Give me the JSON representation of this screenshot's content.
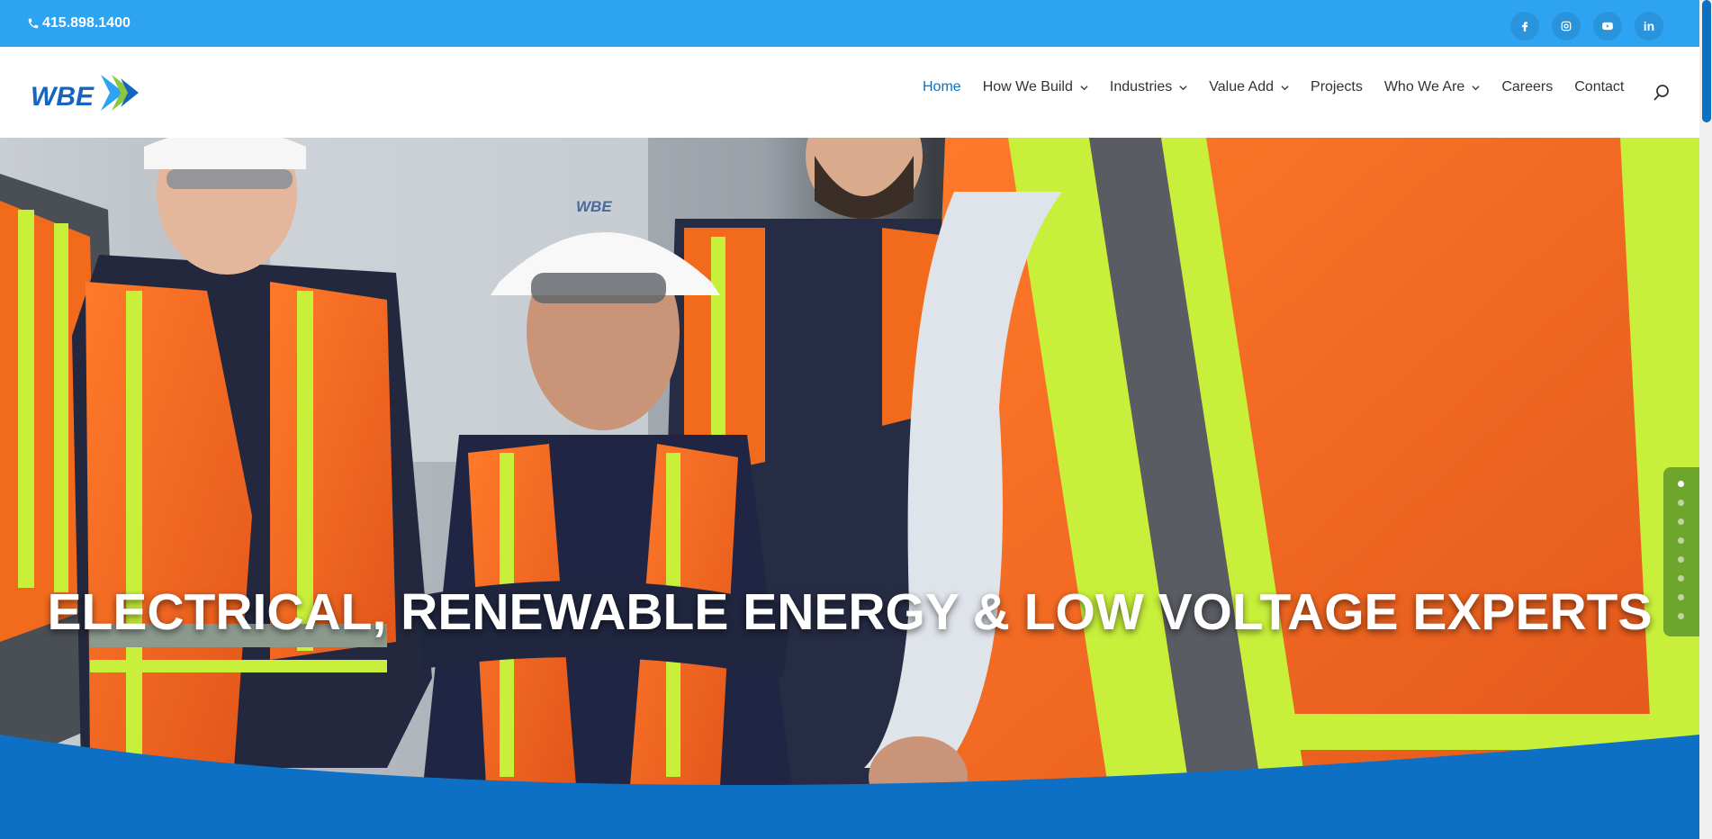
{
  "topbar": {
    "phone": "415.898.1400",
    "social": [
      "facebook-icon",
      "instagram-icon",
      "youtube-icon",
      "linkedin-icon"
    ],
    "linkedin_text": "in"
  },
  "header": {
    "logo_text": "WBE",
    "nav": [
      {
        "label": "Home",
        "active": true,
        "dropdown": false
      },
      {
        "label": "How We Build",
        "active": false,
        "dropdown": true
      },
      {
        "label": "Industries",
        "active": false,
        "dropdown": true
      },
      {
        "label": "Value Add",
        "active": false,
        "dropdown": true
      },
      {
        "label": "Projects",
        "active": false,
        "dropdown": false
      },
      {
        "label": "Who We Are",
        "active": false,
        "dropdown": true
      },
      {
        "label": "Careers",
        "active": false,
        "dropdown": false
      },
      {
        "label": "Contact",
        "active": false,
        "dropdown": false
      }
    ]
  },
  "hero": {
    "headline": "ELECTRICAL, RENEWABLE ENERGY & LOW VOLTAGE EXPERTS",
    "hardhat_logo": "WBE",
    "slides": 8,
    "active_slide": 1
  },
  "colors": {
    "topbar": "#2ea3f2",
    "accent": "#0c71c3",
    "wave": "#0d70c4",
    "vest_orange": "#f26b1d",
    "reflective": "#c8f03a"
  }
}
